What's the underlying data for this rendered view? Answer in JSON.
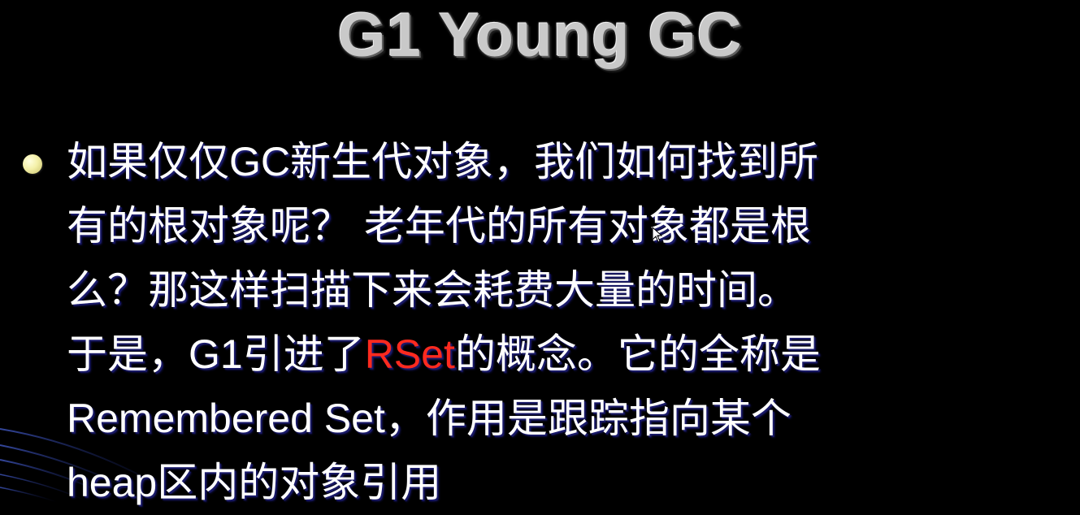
{
  "slide": {
    "title": "G1 Young GC",
    "bullet": {
      "line1_a": "如果仅仅",
      "line1_b": "GC",
      "line1_c": "新生代对象，我们如何找到所",
      "line2": "有的根对象呢？ 老年代的所有对象都是根",
      "line3": "么？那这样扫描下来会耗费大量的时间。",
      "line4_a": "于是，",
      "line4_b": "G1",
      "line4_c": "引进了",
      "line4_highlight": "RSet",
      "line4_d": "的概念。它的全称是",
      "line5_a": "Remembered Set",
      "line5_b": "，作用是跟踪指向某个",
      "line6_a": "heap",
      "line6_b": "区内的对象引用"
    },
    "colors": {
      "background": "#000000",
      "text": "#ffffff",
      "highlight": "#ff2a1f",
      "title": "#c9c9c9",
      "bullet": "#f4f0a8"
    }
  }
}
